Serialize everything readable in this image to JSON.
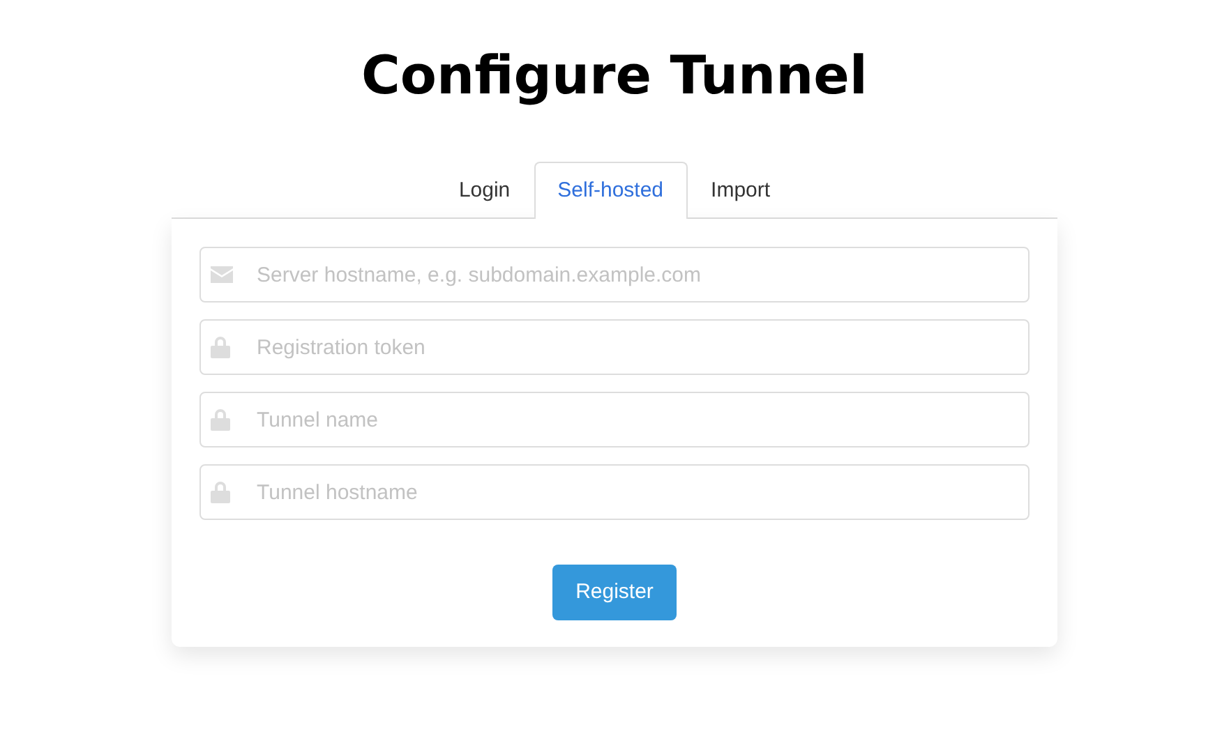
{
  "title": "Configure Tunnel",
  "tabs": [
    {
      "label": "Login",
      "selected": false
    },
    {
      "label": "Self-hosted",
      "selected": true
    },
    {
      "label": "Import",
      "selected": false
    }
  ],
  "fields": [
    {
      "kind": "email",
      "placeholder": "Server hostname, e.g. subdomain.example.com"
    },
    {
      "kind": "lock",
      "placeholder": "Registration token"
    },
    {
      "kind": "lock",
      "placeholder": "Tunnel name"
    },
    {
      "kind": "lock",
      "placeholder": "Tunnel hostname"
    }
  ],
  "button": "Register"
}
